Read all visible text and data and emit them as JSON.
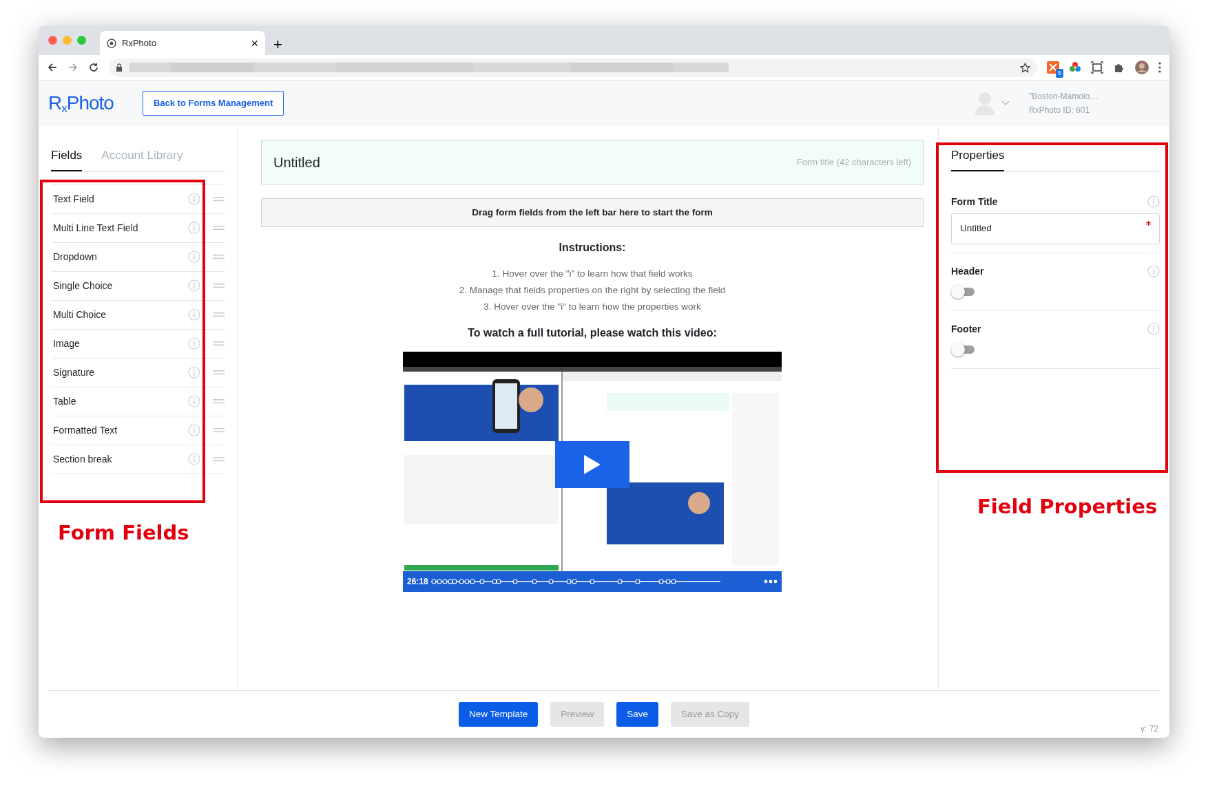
{
  "browser": {
    "tab_title": "RxPhoto",
    "tab_close": "×",
    "new_tab": "+",
    "extension_badge": "5"
  },
  "header": {
    "logo": "R$_{x}$Photo",
    "back_button": "Back to Forms Management",
    "account_name": "\"Boston-Mamolo…",
    "account_id": "RxPhoto ID: 601"
  },
  "left_panel": {
    "tabs": [
      {
        "label": "Fields",
        "selected": true
      },
      {
        "label": "Account Library",
        "selected": false
      }
    ],
    "fields": [
      "Text Field",
      "Multi Line Text Field",
      "Dropdown",
      "Single Choice",
      "Multi Choice",
      "Image",
      "Signature",
      "Table",
      "Formatted Text",
      "Section break"
    ],
    "annotation": "Form Fields"
  },
  "form": {
    "title": "Untitled",
    "title_hint": "Form title (42 characters left)",
    "drop_zone": "Drag form fields from the left bar here to start the form",
    "instructions_heading": "Instructions:",
    "instructions": [
      "1. Hover over the \"i\" to learn how that field works",
      "2. Manage that fields properties on the right by selecting the field",
      "3. Hover over the \"i\" to learn how the properties work"
    ],
    "video_heading": "To watch a full tutorial, please watch this video:",
    "video": {
      "kind": "picture",
      "time": "26:18"
    }
  },
  "properties": {
    "tabs": [
      {
        "label": "Properties",
        "selected": true
      }
    ],
    "form_title": {
      "label": "Form Title",
      "value": "Untitled",
      "required": true
    },
    "toggles": [
      {
        "label": "Header",
        "on": false
      },
      {
        "label": "Footer",
        "on": false
      }
    ],
    "annotation": "Field Properties"
  },
  "footer_buttons": [
    {
      "label": "New Template",
      "disabled": false
    },
    {
      "label": "Preview",
      "disabled": true
    },
    {
      "label": "Save",
      "disabled": false
    },
    {
      "label": "Save as Copy",
      "disabled": true
    }
  ],
  "version": "v: 72"
}
